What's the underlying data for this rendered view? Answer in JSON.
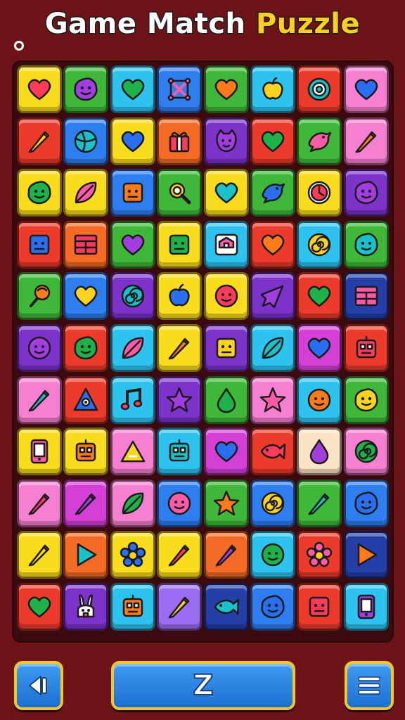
{
  "title": {
    "part1": "Game Match ",
    "part2": "Puzzle"
  },
  "controls": {
    "center_label": "Z"
  },
  "icons": {
    "back": "back-arrow-icon",
    "menu": "menu-icon",
    "coin": "coin-icon"
  },
  "colors": {
    "background": "#6d1419",
    "title_highlight": "#ffcf1f",
    "button_blue": "#2f86e6",
    "button_border": "#f3c72a"
  },
  "board": {
    "rows": 11,
    "cols": 8,
    "tiles": [
      [
        "yellow",
        "heart"
      ],
      [
        "green",
        "blob"
      ],
      [
        "cyan",
        "heart"
      ],
      [
        "blue",
        "cross"
      ],
      [
        "green",
        "heart"
      ],
      [
        "cyan",
        "apple"
      ],
      [
        "red",
        "target"
      ],
      [
        "pink",
        "heart"
      ],
      [
        "red",
        "pencil"
      ],
      [
        "blue",
        "ball"
      ],
      [
        "yellow",
        "heart"
      ],
      [
        "orange",
        "gift"
      ],
      [
        "purple",
        "creature"
      ],
      [
        "red",
        "heart"
      ],
      [
        "green",
        "bird"
      ],
      [
        "pink",
        "pencil"
      ],
      [
        "yellow",
        "blob"
      ],
      [
        "yellow",
        "leaf"
      ],
      [
        "blue",
        "box"
      ],
      [
        "green",
        "magnifier"
      ],
      [
        "yellow",
        "heart"
      ],
      [
        "green",
        "bird"
      ],
      [
        "yellow",
        "clock"
      ],
      [
        "purple",
        "blob"
      ],
      [
        "red",
        "box"
      ],
      [
        "orange",
        "window"
      ],
      [
        "green",
        "heart"
      ],
      [
        "yellow",
        "box"
      ],
      [
        "cyan",
        "house"
      ],
      [
        "red",
        "heart"
      ],
      [
        "cyan",
        "spiral"
      ],
      [
        "green",
        "blob"
      ],
      [
        "green",
        "lollipop"
      ],
      [
        "blue",
        "heart"
      ],
      [
        "purple",
        "spiral"
      ],
      [
        "yellow",
        "apple"
      ],
      [
        "yellow",
        "face"
      ],
      [
        "purple",
        "arrow"
      ],
      [
        "red",
        "heart"
      ],
      [
        "navy",
        "window"
      ],
      [
        "purple",
        "face"
      ],
      [
        "red",
        "blob"
      ],
      [
        "cyan",
        "leaf"
      ],
      [
        "yellow",
        "pencil"
      ],
      [
        "purple",
        "box"
      ],
      [
        "cyan",
        "leaf"
      ],
      [
        "magenta",
        "heart"
      ],
      [
        "red",
        "robot"
      ],
      [
        "pink",
        "pencil"
      ],
      [
        "red",
        "eye"
      ],
      [
        "cyan",
        "note"
      ],
      [
        "purple",
        "star"
      ],
      [
        "green",
        "drop"
      ],
      [
        "pink",
        "star"
      ],
      [
        "cyan",
        "face"
      ],
      [
        "green",
        "blob"
      ],
      [
        "yellow",
        "phone"
      ],
      [
        "yellow",
        "robot"
      ],
      [
        "pink",
        "triangle"
      ],
      [
        "cyan",
        "robot"
      ],
      [
        "magenta",
        "heart"
      ],
      [
        "red",
        "fish"
      ],
      [
        "cream",
        "drop"
      ],
      [
        "pink",
        "spiral"
      ],
      [
        "pink",
        "pencil"
      ],
      [
        "magenta",
        "pencil"
      ],
      [
        "pink",
        "leaf"
      ],
      [
        "blue",
        "face"
      ],
      [
        "green",
        "star"
      ],
      [
        "blue",
        "spiral"
      ],
      [
        "green",
        "pencil"
      ],
      [
        "blue",
        "blob"
      ],
      [
        "yellow",
        "pencil"
      ],
      [
        "orange",
        "play"
      ],
      [
        "yellow",
        "flower"
      ],
      [
        "yellow",
        "pencil"
      ],
      [
        "orange",
        "pencil"
      ],
      [
        "cyan",
        "face"
      ],
      [
        "red",
        "flower"
      ],
      [
        "navy",
        "play"
      ],
      [
        "red",
        "heart"
      ],
      [
        "purple",
        "bunny"
      ],
      [
        "cyan",
        "robot"
      ],
      [
        "violet",
        "pencil"
      ],
      [
        "navy",
        "fish"
      ],
      [
        "blue",
        "blob"
      ],
      [
        "red",
        "box"
      ],
      [
        "cyan",
        "phone"
      ]
    ]
  }
}
